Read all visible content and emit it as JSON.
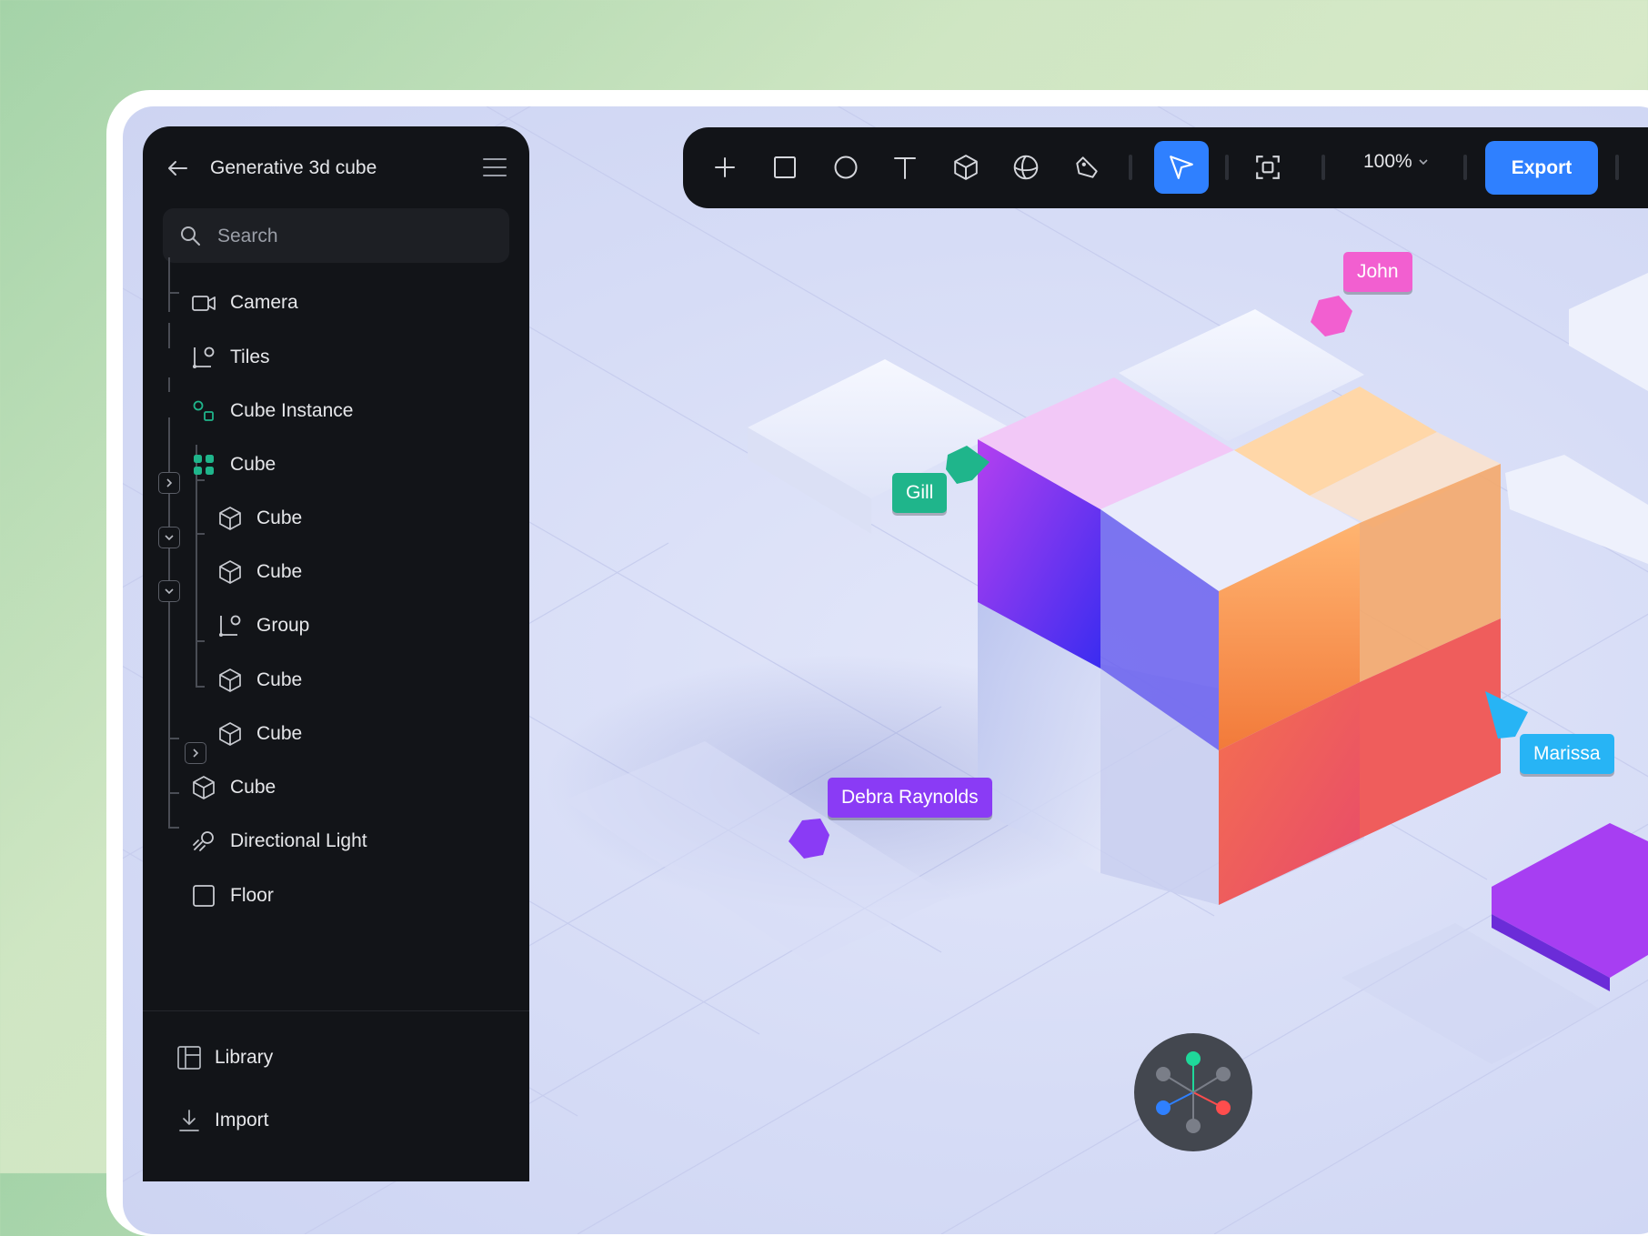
{
  "sidebar": {
    "title": "Generative 3d cube",
    "search_placeholder": "Search",
    "tree": [
      {
        "label": "Camera",
        "icon": "camera-icon"
      },
      {
        "label": "Tiles",
        "icon": "group-icon"
      },
      {
        "label": "Cube Instance",
        "icon": "instance-icon"
      },
      {
        "label": "Cube",
        "icon": "component-icon"
      },
      {
        "label": "Cube",
        "icon": "cube-icon"
      },
      {
        "label": "Cube",
        "icon": "cube-icon"
      },
      {
        "label": "Group",
        "icon": "group-icon"
      },
      {
        "label": "Cube",
        "icon": "cube-icon"
      },
      {
        "label": "Cube",
        "icon": "cube-icon"
      },
      {
        "label": "Cube",
        "icon": "cube-icon"
      },
      {
        "label": "Directional Light",
        "icon": "light-icon"
      },
      {
        "label": "Floor",
        "icon": "square-icon"
      }
    ],
    "footer": [
      {
        "label": "Library",
        "icon": "library-icon"
      },
      {
        "label": "Import",
        "icon": "import-icon"
      }
    ]
  },
  "toolbar": {
    "tools": [
      "plus-icon",
      "rectangle-icon",
      "ellipse-icon",
      "text-icon",
      "cube-icon",
      "sphere-icon",
      "pen-icon",
      "select-arrow-icon",
      "frame-icon"
    ],
    "active_tool": "select-arrow-icon",
    "zoom": "100%",
    "export_label": "Export"
  },
  "collaborators": [
    {
      "name": "John",
      "color": "#f25fd0"
    },
    {
      "name": "Gill",
      "color": "#1fb58b"
    },
    {
      "name": "Marissa",
      "color": "#27b4f5"
    },
    {
      "name": "Debra Raynolds",
      "color": "#8a3bf5"
    }
  ],
  "colors": {
    "accent": "#2f80ff",
    "panel": "#121418"
  }
}
